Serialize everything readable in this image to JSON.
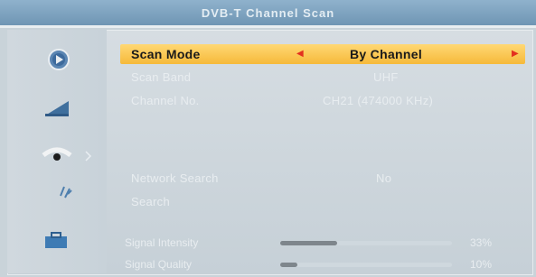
{
  "window": {
    "title": "DVB-T Channel Scan"
  },
  "menu": [
    {
      "label": "Scan Mode",
      "value": "By Channel",
      "selected": true
    },
    {
      "label": "Scan Band",
      "value": "UHF"
    },
    {
      "label": "Channel No.",
      "value": "CH21 (474000 KHz)"
    },
    {
      "label": "Network Search",
      "value": "No"
    },
    {
      "label": "Search",
      "value": ""
    }
  ],
  "signal": {
    "intensity": {
      "label": "Signal Intensity",
      "value": "33%",
      "level": 0.33
    },
    "quality": {
      "label": "Signal Quality",
      "value": "10%",
      "level": 0.1
    }
  },
  "colors": {
    "accent": "#f6b93a",
    "arrow": "#e3301f",
    "text": "#e8edf0"
  },
  "sidebar_icons": [
    "play-icon",
    "picture-icon",
    "eye-icon",
    "sparkle-icon",
    "toolbox-icon"
  ]
}
